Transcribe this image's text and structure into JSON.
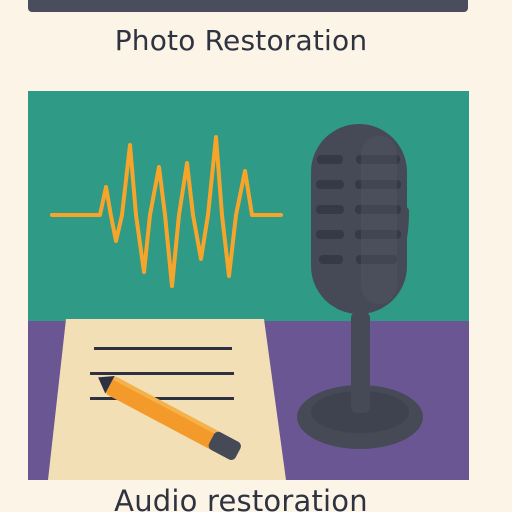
{
  "cards": [
    {
      "title": "Photo Restoration"
    },
    {
      "title": "Audio restoration",
      "illustration_icons": [
        "audio-waveform-icon",
        "microphone-icon",
        "paper-sheet-icon",
        "pencil-icon"
      ]
    }
  ],
  "colors": {
    "page_background": "#fbf4e7",
    "top_panel": "#4a4d5d",
    "teal_background": "#2f9a86",
    "purple_table": "#6b5694",
    "waveform": "#f6a52a",
    "microphone": "#464a56",
    "paper": "#f3dfb5",
    "pencil": "#f39a2b",
    "text": "#2f3340"
  }
}
